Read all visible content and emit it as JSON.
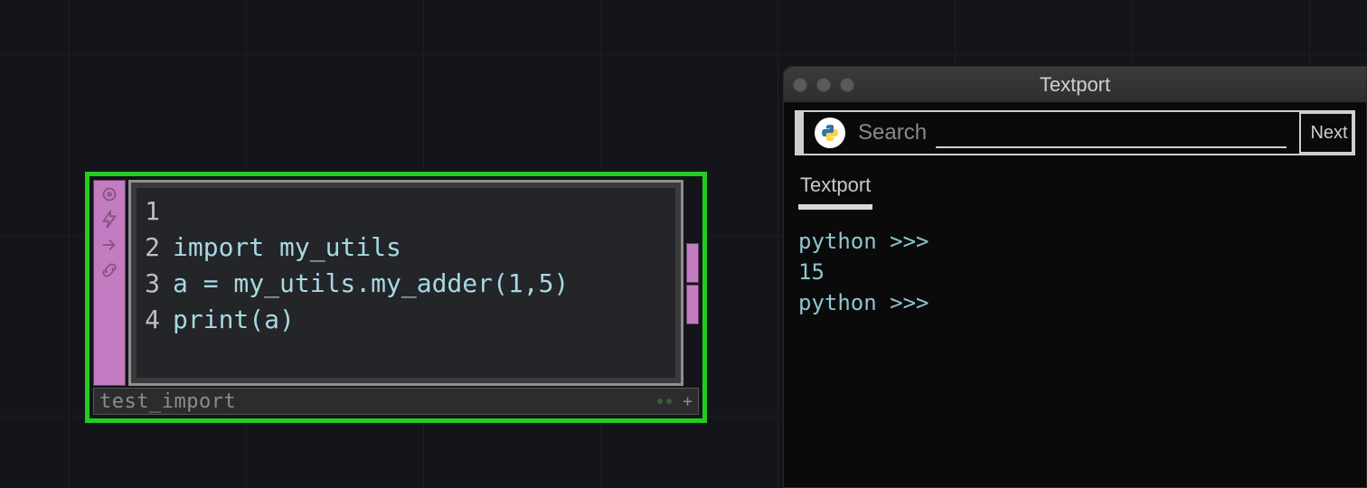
{
  "node": {
    "name": "test_import",
    "side_icons": [
      "target-icon",
      "bolt-icon",
      "arrow-right-icon",
      "link-icon"
    ],
    "code_lines": [
      {
        "n": "1",
        "text": "import my_utils"
      },
      {
        "n": "2",
        "text": "a = my_utils.my_adder(1,5)"
      },
      {
        "n": "3",
        "text": "print(a)"
      },
      {
        "n": "4",
        "text": ""
      }
    ]
  },
  "textport": {
    "title": "Textport",
    "search_label": "Search",
    "search_value": "",
    "next_label": "Next",
    "tab_label": "Textport",
    "console_lines": [
      "python >>> ",
      "15",
      "python >>> "
    ]
  }
}
